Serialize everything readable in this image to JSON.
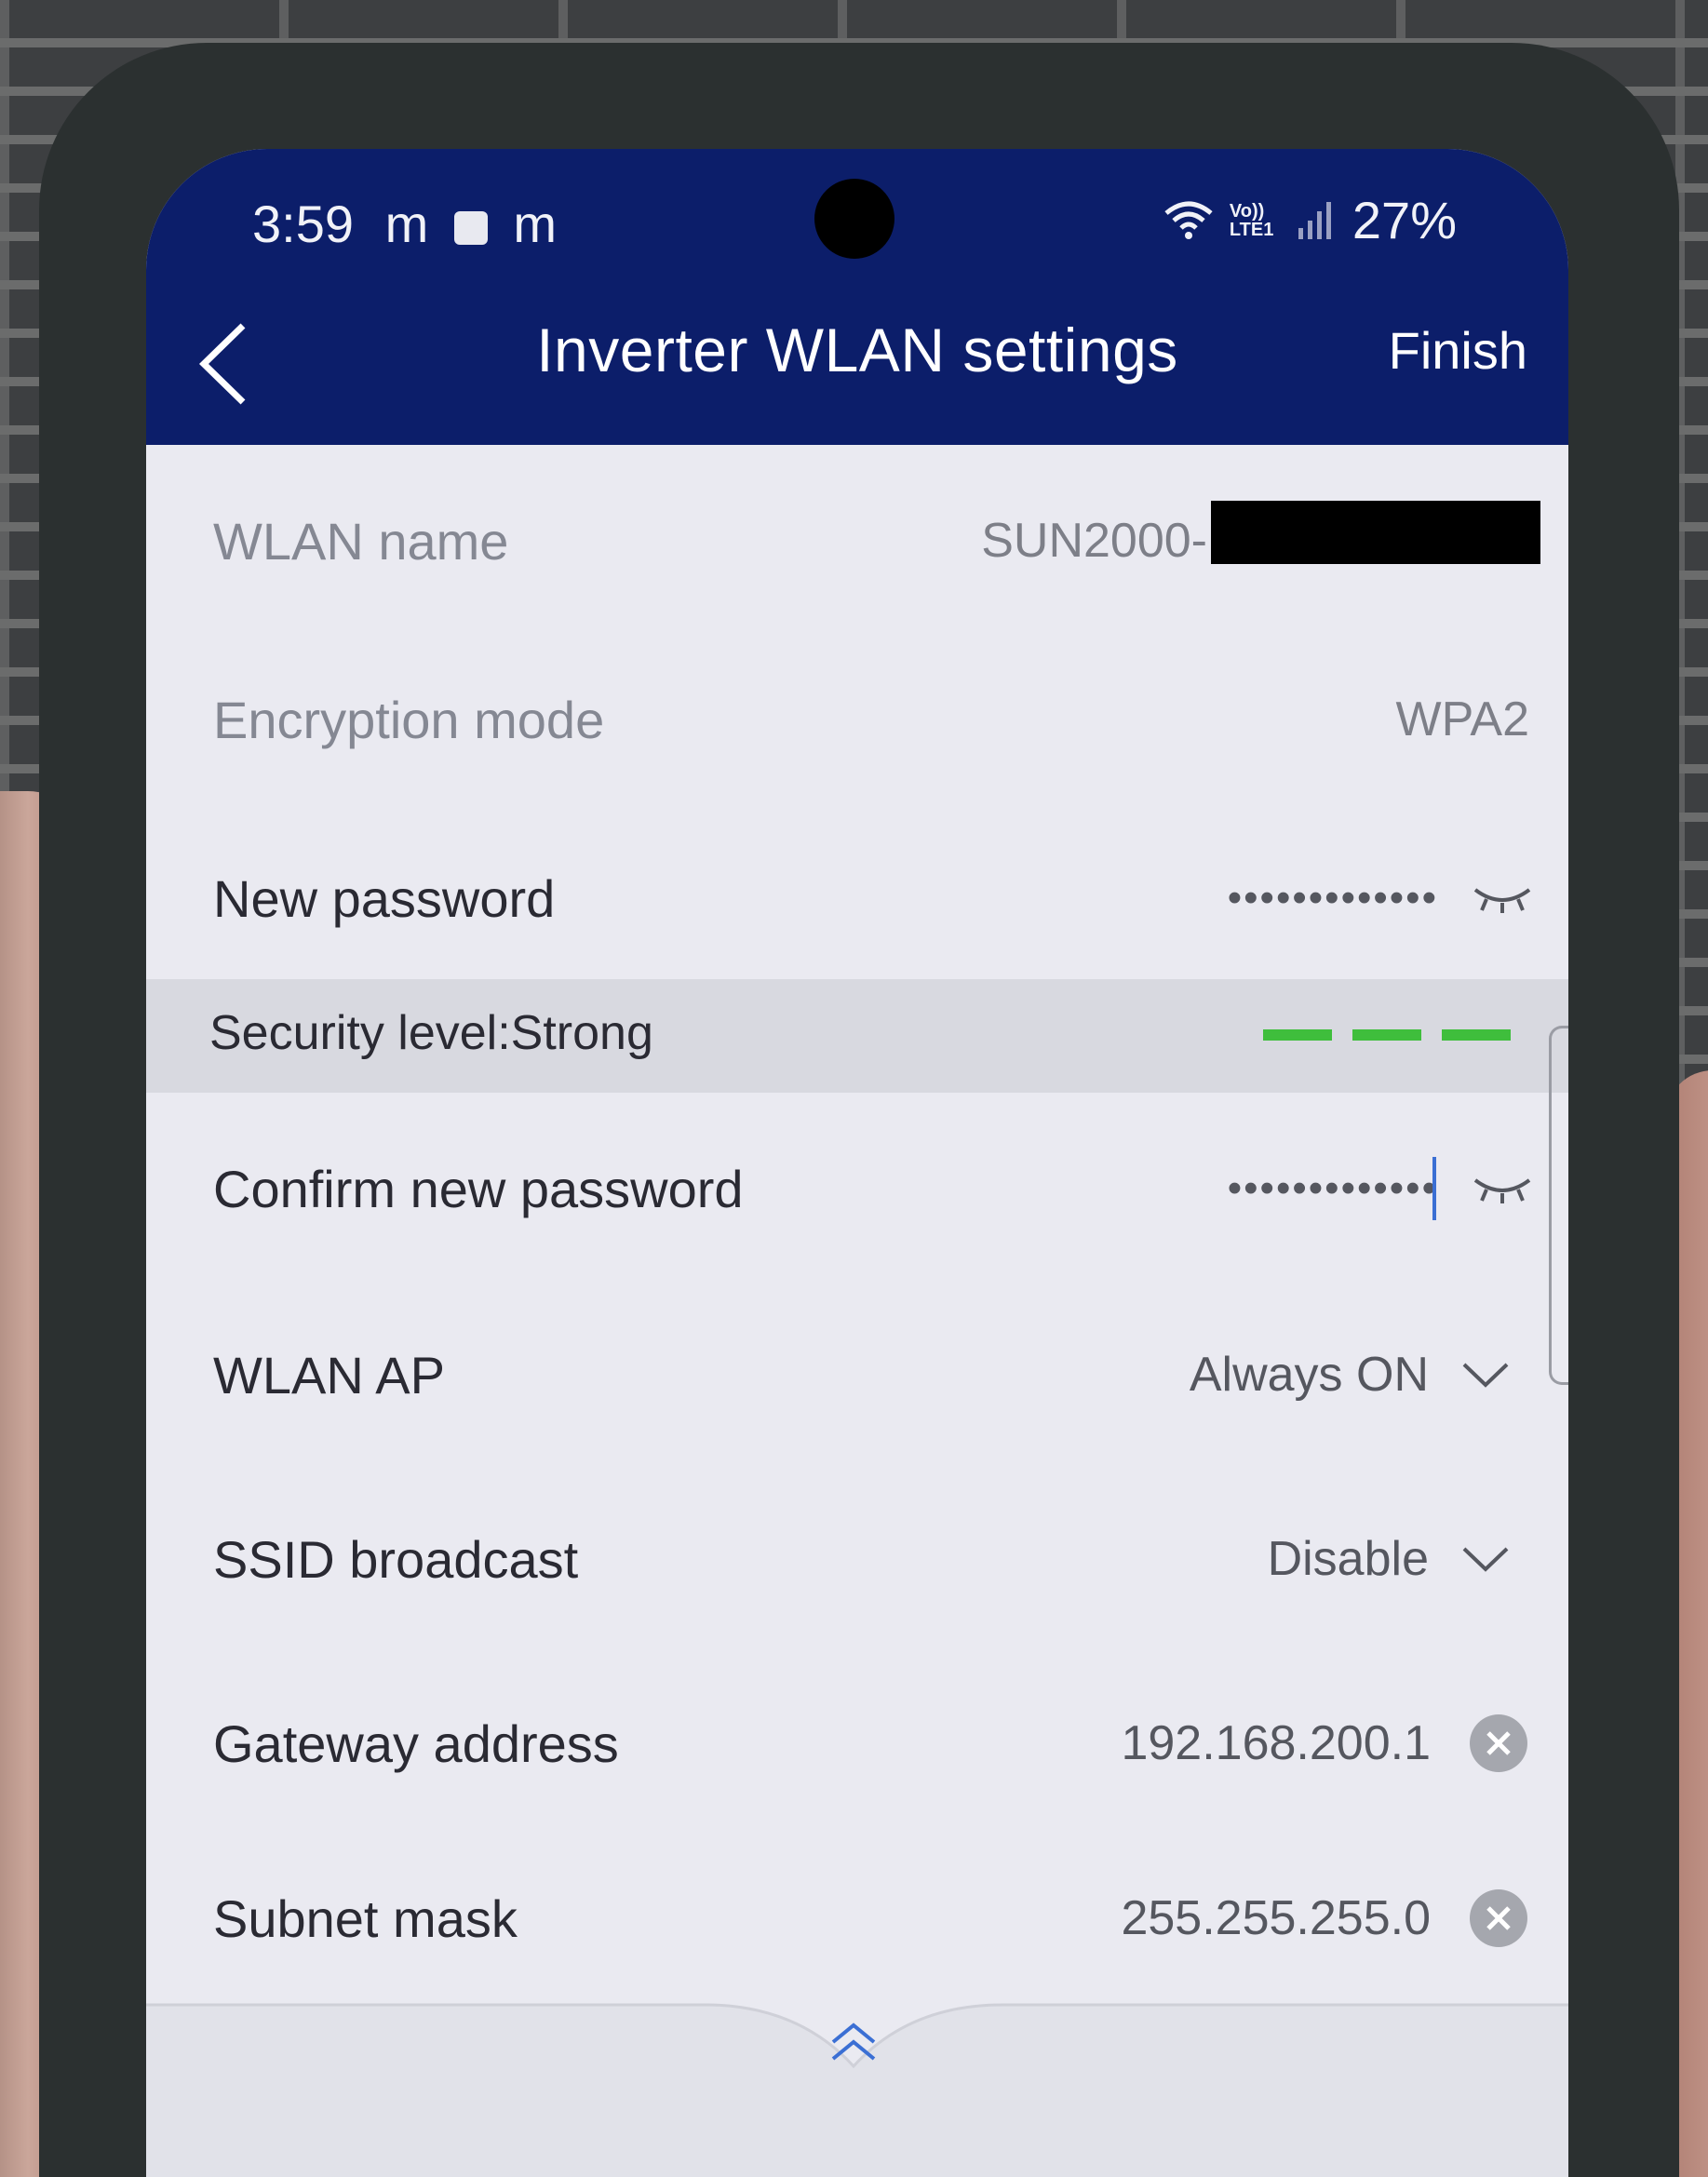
{
  "status_bar": {
    "time": "3:59",
    "battery": "27%",
    "indicators": [
      "m",
      "m"
    ],
    "network_label": "Vo)) LTE1"
  },
  "header": {
    "title": "Inverter WLAN settings",
    "finish_label": "Finish"
  },
  "settings": {
    "wlan_name": {
      "label": "WLAN name",
      "value": "SUN2000-"
    },
    "encryption_mode": {
      "label": "Encryption mode",
      "value": "WPA2"
    },
    "new_password": {
      "label": "New password",
      "value": "•••••••••••••"
    },
    "security_level": {
      "label": "Security level:Strong",
      "strength_bars": 3,
      "color": "#3fbe3c"
    },
    "confirm_password": {
      "label": "Confirm new password",
      "value": "•••••••••••••"
    },
    "wlan_ap": {
      "label": "WLAN AP",
      "value": "Always ON"
    },
    "ssid_broadcast": {
      "label": "SSID broadcast",
      "value": "Disable"
    },
    "gateway_address": {
      "label": "Gateway address",
      "value": "192.168.200.1"
    },
    "subnet_mask": {
      "label": "Subnet mask",
      "value": "255.255.255.0"
    }
  },
  "colors": {
    "header_bg": "#0c1e6a",
    "screen_bg": "#eaeaf1",
    "accent_blue": "#3b6fd4"
  },
  "icons": [
    "back-arrow-icon",
    "eye-closed-icon",
    "chevron-down-icon",
    "clear-icon",
    "expand-up-icon",
    "wifi-icon",
    "signal-icon"
  ]
}
